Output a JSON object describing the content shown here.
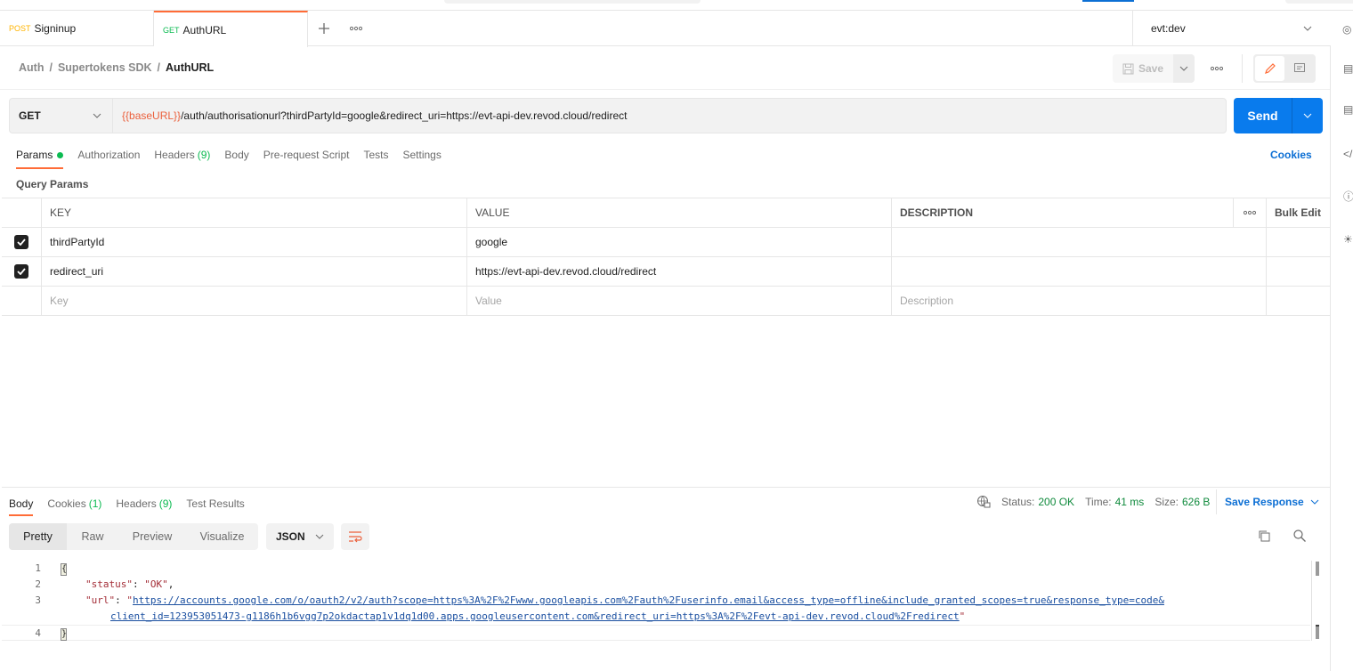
{
  "tabs": [
    {
      "method": "POST",
      "name": "Signinup",
      "active": false
    },
    {
      "method": "GET",
      "name": "AuthURL",
      "active": true
    }
  ],
  "tab_actions": {
    "new_tab": "+",
    "more": "ooo"
  },
  "environment": {
    "selected": "evt:dev"
  },
  "breadcrumb": {
    "items": [
      "Auth",
      "Supertokens SDK"
    ],
    "current": "AuthURL",
    "separator": "/"
  },
  "toolbar": {
    "save_label": "Save",
    "more": "ooo"
  },
  "request": {
    "method": "GET",
    "url_variable": "{{baseURL}}",
    "url_rest": "/auth/authorisationurl?thirdPartyId=google&redirect_uri=https://evt-api-dev.revod.cloud/redirect",
    "send_label": "Send"
  },
  "request_tabs": [
    {
      "label": "Params",
      "dot": true,
      "active": true
    },
    {
      "label": "Authorization"
    },
    {
      "label": "Headers",
      "count": "(9)"
    },
    {
      "label": "Body"
    },
    {
      "label": "Pre-request Script"
    },
    {
      "label": "Tests"
    },
    {
      "label": "Settings"
    }
  ],
  "cookies_link": "Cookies",
  "query_params": {
    "title": "Query Params",
    "headers": {
      "key": "KEY",
      "value": "VALUE",
      "description": "DESCRIPTION",
      "more": "ooo",
      "bulk_edit": "Bulk Edit"
    },
    "rows": [
      {
        "checked": true,
        "key": "thirdPartyId",
        "value": "google",
        "description": ""
      },
      {
        "checked": true,
        "key": "redirect_uri",
        "value": "https://evt-api-dev.revod.cloud/redirect",
        "description": ""
      }
    ],
    "placeholders": {
      "key": "Key",
      "value": "Value",
      "description": "Description"
    }
  },
  "response": {
    "tabs": [
      {
        "label": "Body",
        "active": true
      },
      {
        "label": "Cookies",
        "count": "(1)"
      },
      {
        "label": "Headers",
        "count": "(9)"
      },
      {
        "label": "Test Results"
      }
    ],
    "status_label": "Status:",
    "status": "200 OK",
    "time_label": "Time:",
    "time": "41 ms",
    "size_label": "Size:",
    "size": "626 B",
    "save_response": "Save Response",
    "views": [
      "Pretty",
      "Raw",
      "Preview",
      "Visualize"
    ],
    "active_view": "Pretty",
    "format": "JSON",
    "lines": [
      {
        "no": "1"
      },
      {
        "no": "2",
        "key": "\"status\"",
        "value": "\"OK\""
      },
      {
        "no": "3",
        "key": "\"url\"",
        "value_line1": "https://accounts.google.com/o/oauth2/v2/auth?scope=https%3A%2F%2Fwww.googleapis.com%2Fauth%2Fuserinfo.email&access_type=offline&include_granted_scopes=true&response_type=code&",
        "value_line2": "client_id=123953051473-g1186h1b6vgg7p2okdactap1v1dq1d00.apps.googleusercontent.com&redirect_uri=https%3A%2F%2Fevt-api-dev.revod.cloud%2Fredirect"
      },
      {
        "no": "4"
      }
    ]
  },
  "colors": {
    "accent": "#ff6c37",
    "primary": "#097bed",
    "success": "#0cbb52",
    "link": "#0c6fd4"
  }
}
